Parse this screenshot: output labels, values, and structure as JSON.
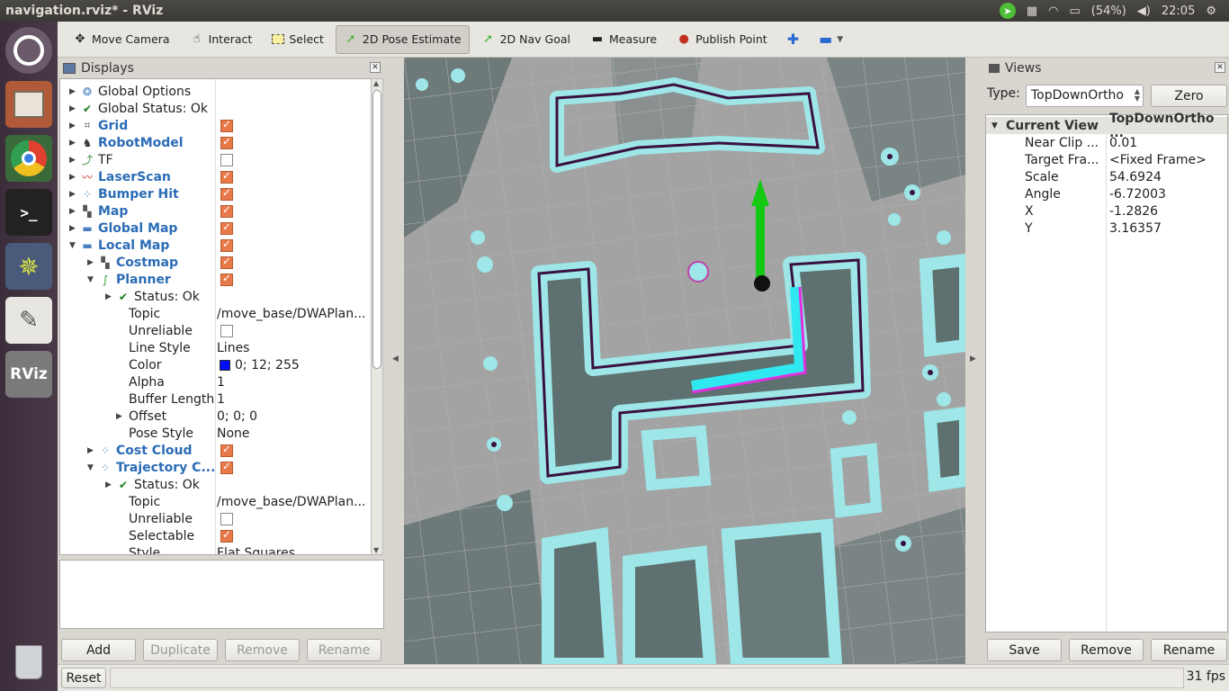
{
  "window": {
    "title": "navigation.rviz* - RViz"
  },
  "tray": {
    "battery": "(54%)",
    "clock": "22:05"
  },
  "toolbar": {
    "move_camera": "Move Camera",
    "interact": "Interact",
    "select": "Select",
    "pose_estimate": "2D Pose Estimate",
    "nav_goal": "2D Nav Goal",
    "measure": "Measure",
    "publish_point": "Publish Point"
  },
  "displays": {
    "title": "Displays",
    "rows": [
      {
        "label": "Global Options",
        "value": ""
      },
      {
        "label": "Global Status: Ok",
        "value": ""
      },
      {
        "label": "Grid",
        "value": ""
      },
      {
        "label": "RobotModel",
        "value": ""
      },
      {
        "label": "TF",
        "value": ""
      },
      {
        "label": "LaserScan",
        "value": ""
      },
      {
        "label": "Bumper Hit",
        "value": ""
      },
      {
        "label": "Map",
        "value": ""
      },
      {
        "label": "Global Map",
        "value": ""
      },
      {
        "label": "Local Map",
        "value": ""
      },
      {
        "label": "Costmap",
        "value": ""
      },
      {
        "label": "Planner",
        "value": ""
      },
      {
        "label": "Status: Ok",
        "value": ""
      },
      {
        "label": "Topic",
        "value": "/move_base/DWAPlan..."
      },
      {
        "label": "Unreliable",
        "value": ""
      },
      {
        "label": "Line Style",
        "value": "Lines"
      },
      {
        "label": "Color",
        "value": "0; 12; 255"
      },
      {
        "label": "Alpha",
        "value": "1"
      },
      {
        "label": "Buffer Length",
        "value": "1"
      },
      {
        "label": "Offset",
        "value": "0; 0; 0"
      },
      {
        "label": "Pose Style",
        "value": "None"
      },
      {
        "label": "Cost Cloud",
        "value": ""
      },
      {
        "label": "Trajectory C...",
        "value": ""
      },
      {
        "label": "Status: Ok",
        "value": ""
      },
      {
        "label": "Topic",
        "value": "/move_base/DWAPlan..."
      },
      {
        "label": "Unreliable",
        "value": ""
      },
      {
        "label": "Selectable",
        "value": ""
      },
      {
        "label": "Style",
        "value": "Flat Squares"
      }
    ],
    "planner_color": "#000cff",
    "buttons": {
      "add": "Add",
      "duplicate": "Duplicate",
      "remove": "Remove",
      "rename": "Rename"
    }
  },
  "views": {
    "title": "Views",
    "type_label": "Type:",
    "type_value": "TopDownOrtho",
    "zero": "Zero",
    "header_key": "Current View",
    "header_val": "TopDownOrtho ...",
    "props": [
      {
        "k": "Near Clip ...",
        "v": "0.01"
      },
      {
        "k": "Target Fra...",
        "v": "<Fixed Frame>"
      },
      {
        "k": "Scale",
        "v": "54.6924"
      },
      {
        "k": "Angle",
        "v": "-6.72003"
      },
      {
        "k": "X",
        "v": "-1.2826"
      },
      {
        "k": "Y",
        "v": "3.16357"
      }
    ],
    "buttons": {
      "save": "Save",
      "remove": "Remove",
      "rename": "Rename"
    }
  },
  "status": {
    "reset": "Reset",
    "fps": "31 fps"
  }
}
